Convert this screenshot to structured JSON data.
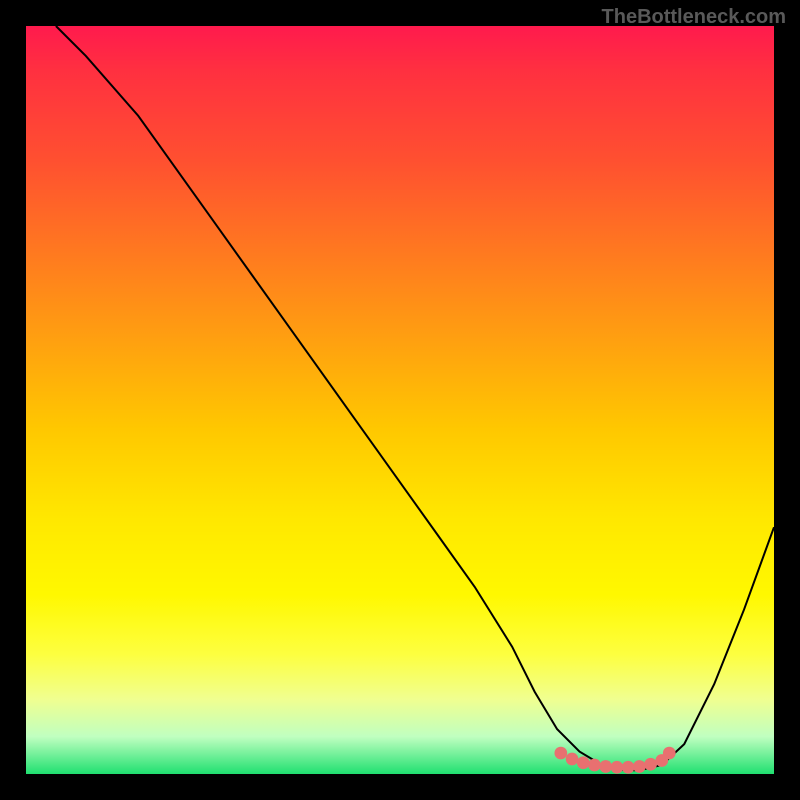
{
  "watermark": "TheBottleneck.com",
  "chart_data": {
    "type": "line",
    "title": "",
    "xlabel": "",
    "ylabel": "",
    "xlim": [
      0,
      100
    ],
    "ylim": [
      0,
      100
    ],
    "series": [
      {
        "name": "curve",
        "x": [
          4,
          8,
          15,
          25,
          35,
          45,
          55,
          60,
          65,
          68,
          71,
          74,
          77,
          80,
          82,
          85,
          88,
          92,
          96,
          100
        ],
        "y": [
          100,
          96,
          88,
          74,
          60,
          46,
          32,
          25,
          17,
          11,
          6,
          3,
          1.2,
          0.5,
          0.5,
          1.2,
          4,
          12,
          22,
          33
        ],
        "color": "#000000"
      }
    ],
    "markers": {
      "name": "highlight-flat-region",
      "x": [
        71.5,
        73,
        74.5,
        76,
        77.5,
        79,
        80.5,
        82,
        83.5,
        85,
        86
      ],
      "y": [
        2.8,
        2.0,
        1.5,
        1.2,
        1.0,
        0.9,
        0.9,
        1.0,
        1.3,
        1.8,
        2.8
      ],
      "color": "#e87070"
    }
  }
}
